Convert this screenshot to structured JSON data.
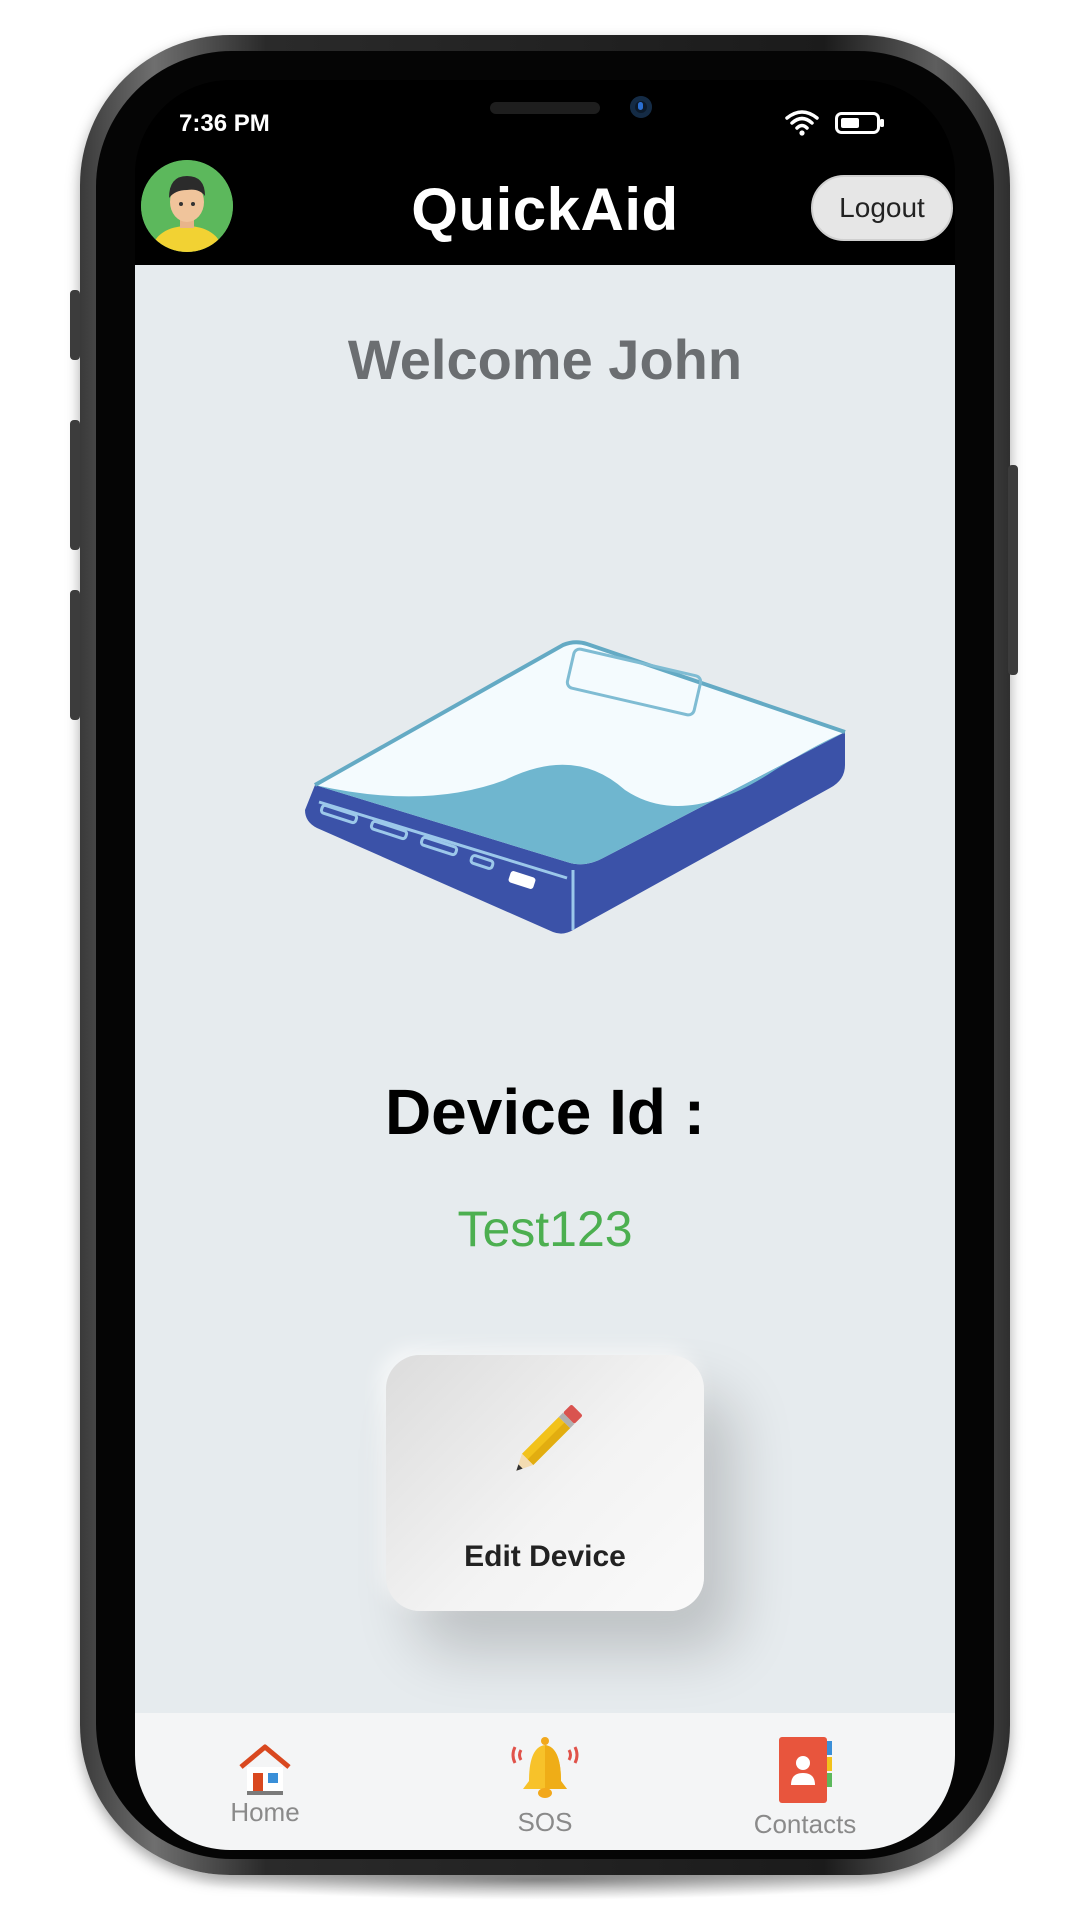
{
  "status_bar": {
    "time": "7:36 PM"
  },
  "header": {
    "title": "QuickAid",
    "logout_label": "Logout"
  },
  "main": {
    "welcome": "Welcome John",
    "device_id_label": "Device Id :",
    "device_id_value": "Test123",
    "edit_button_label": "Edit Device"
  },
  "bottom_nav": {
    "items": [
      {
        "label": "Home",
        "icon": "home-icon"
      },
      {
        "label": "SOS",
        "icon": "bell-icon"
      },
      {
        "label": "Contacts",
        "icon": "contacts-icon"
      }
    ]
  },
  "colors": {
    "header_bg": "#000000",
    "content_bg": "#e6ebee",
    "device_id_value": "#4caf50",
    "welcome_text": "#6b6e71"
  }
}
